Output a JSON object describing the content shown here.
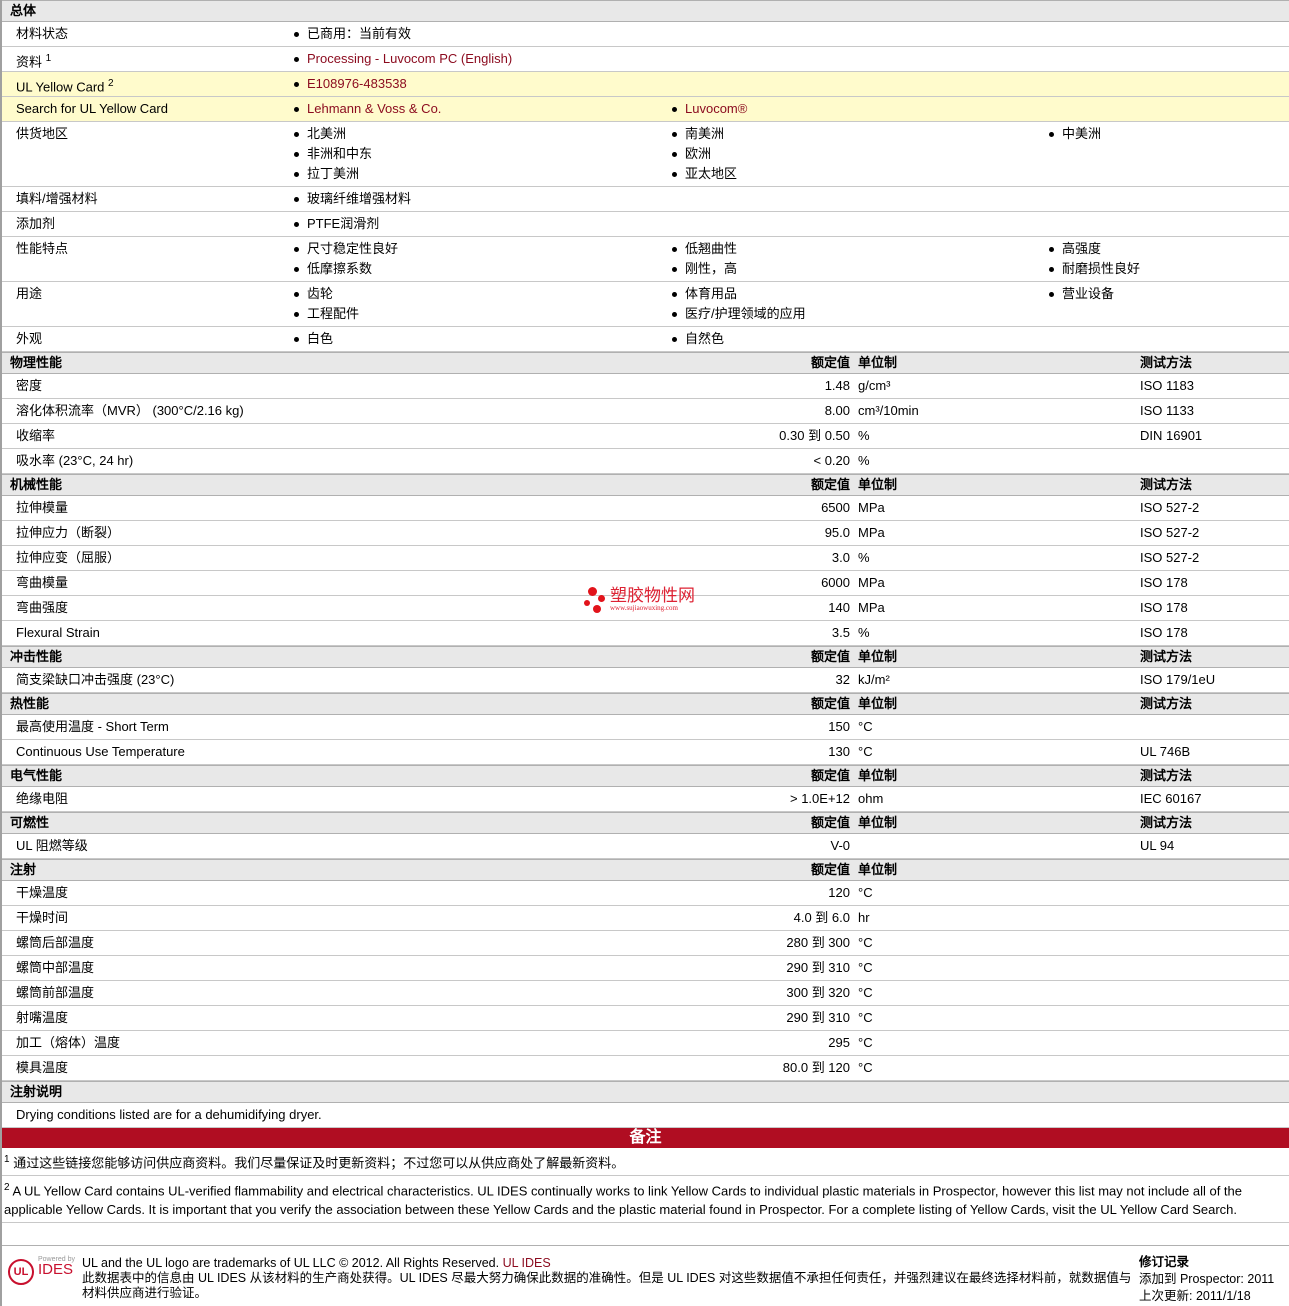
{
  "general": {
    "title": "总体",
    "rows": [
      {
        "label": "材料状态",
        "cols": [
          [
            "已商用：当前有效"
          ]
        ]
      },
      {
        "label": "资料",
        "sup": "1",
        "link": true,
        "cols": [
          [
            "Processing - Luvocom PC (English)"
          ]
        ]
      },
      {
        "label": "UL Yellow Card",
        "sup": "2",
        "link": true,
        "hl": true,
        "cols": [
          [
            "E108976-483538"
          ]
        ]
      },
      {
        "label": "Search for UL Yellow Card",
        "link": true,
        "hl": true,
        "cols": [
          [
            "Lehmann & Voss & Co."
          ],
          [
            "Luvocom®"
          ]
        ]
      },
      {
        "label": "供货地区",
        "cols": [
          [
            "北美洲",
            "非洲和中东",
            "拉丁美洲"
          ],
          [
            "南美洲",
            "欧洲",
            "亚太地区"
          ],
          [
            "中美洲"
          ]
        ]
      },
      {
        "label": "填料/增强材料",
        "cols": [
          [
            "玻璃纤维增强材料"
          ]
        ]
      },
      {
        "label": "添加剂",
        "cols": [
          [
            "PTFE润滑剂"
          ]
        ]
      },
      {
        "label": "性能特点",
        "cols": [
          [
            "尺寸稳定性良好",
            "低摩擦系数"
          ],
          [
            "低翘曲性",
            "刚性，高"
          ],
          [
            "高强度",
            "耐磨损性良好"
          ]
        ]
      },
      {
        "label": "用途",
        "cols": [
          [
            "齿轮",
            "工程配件"
          ],
          [
            "体育用品",
            "医疗/护理领域的应用"
          ],
          [
            "营业设备"
          ]
        ]
      },
      {
        "label": "外观",
        "cols": [
          [
            "白色"
          ],
          [
            "自然色"
          ]
        ]
      }
    ]
  },
  "sections": [
    {
      "title": "物理性能",
      "value": "额定值",
      "unit": "单位制",
      "method": "测试方法",
      "rows": [
        {
          "label": "密度",
          "value": "1.48",
          "unit": "g/cm³",
          "method": "ISO 1183"
        },
        {
          "label": "溶化体积流率（MVR）  (300°C/2.16 kg)",
          "value": "8.00",
          "unit": "cm³/10min",
          "method": "ISO 1133"
        },
        {
          "label": "收缩率",
          "value": "0.30 到  0.50",
          "unit": "%",
          "method": "DIN 16901"
        },
        {
          "label": "吸水率  (23°C, 24 hr)",
          "value": "< 0.20",
          "unit": "%",
          "method": ""
        }
      ]
    },
    {
      "title": "机械性能",
      "value": "额定值",
      "unit": "单位制",
      "method": "测试方法",
      "rows": [
        {
          "label": "拉伸模量",
          "value": "6500",
          "unit": "MPa",
          "method": "ISO 527-2"
        },
        {
          "label": "拉伸应力（断裂）",
          "value": "95.0",
          "unit": "MPa",
          "method": "ISO 527-2"
        },
        {
          "label": "拉伸应变（屈服）",
          "value": "3.0",
          "unit": "%",
          "method": "ISO 527-2"
        },
        {
          "label": "弯曲模量",
          "value": "6000",
          "unit": "MPa",
          "method": "ISO 178"
        },
        {
          "label": "弯曲强度",
          "value": "140",
          "unit": "MPa",
          "method": "ISO 178"
        },
        {
          "label": "Flexural Strain",
          "value": "3.5",
          "unit": "%",
          "method": "ISO 178"
        }
      ]
    },
    {
      "title": "冲击性能",
      "value": "额定值",
      "unit": "单位制",
      "method": "测试方法",
      "rows": [
        {
          "label": "简支梁缺口冲击强度  (23°C)",
          "value": "32",
          "unit": "kJ/m²",
          "method": "ISO 179/1eU"
        }
      ]
    },
    {
      "title": "热性能",
      "value": "额定值",
      "unit": "单位制",
      "method": "测试方法",
      "rows": [
        {
          "label": "最高使用温度  - Short Term",
          "value": "150",
          "unit": "°C",
          "method": ""
        },
        {
          "label": "Continuous Use Temperature",
          "value": "130",
          "unit": "°C",
          "method": "UL 746B"
        }
      ]
    },
    {
      "title": "电气性能",
      "value": "额定值",
      "unit": "单位制",
      "method": "测试方法",
      "rows": [
        {
          "label": "绝缘电阻",
          "value": "> 1.0E+12",
          "unit": "ohm",
          "method": "IEC 60167"
        }
      ]
    },
    {
      "title": "可燃性",
      "value": "额定值",
      "unit": "单位制",
      "method": "测试方法",
      "rows": [
        {
          "label": "UL 阻燃等级",
          "value": "V-0",
          "unit": "",
          "method": "UL 94"
        }
      ]
    },
    {
      "title": "注射",
      "value": "额定值",
      "unit": "单位制",
      "method": "",
      "rows": [
        {
          "label": "干燥温度",
          "value": "120",
          "unit": "°C",
          "method": ""
        },
        {
          "label": "干燥时间",
          "value": "4.0 到  6.0",
          "unit": "hr",
          "method": ""
        },
        {
          "label": "螺筒后部温度",
          "value": "280 到  300",
          "unit": "°C",
          "method": ""
        },
        {
          "label": "螺筒中部温度",
          "value": "290 到  310",
          "unit": "°C",
          "method": ""
        },
        {
          "label": "螺筒前部温度",
          "value": "300 到  320",
          "unit": "°C",
          "method": ""
        },
        {
          "label": "射嘴温度",
          "value": "290 到  310",
          "unit": "°C",
          "method": ""
        },
        {
          "label": "加工（熔体）温度",
          "value": "295",
          "unit": "°C",
          "method": ""
        },
        {
          "label": "模具温度",
          "value": "80.0 到  120",
          "unit": "°C",
          "method": ""
        }
      ]
    }
  ],
  "injection_notes": {
    "title": "注射说明",
    "text": "Drying conditions listed are for a dehumidifying dryer."
  },
  "notes": {
    "title": "备注",
    "footnotes": [
      {
        "num": "1",
        "text": "通过这些链接您能够访问供应商资料。我们尽量保证及时更新资料；不过您可以从供应商处了解最新资料。"
      },
      {
        "num": "2",
        "text": "A UL Yellow Card contains UL-verified flammability and electrical characteristics. UL IDES continually works to link Yellow Cards to individual plastic materials in Prospector, however this list may not include all of the applicable Yellow Cards. It is important that you verify the association between these Yellow Cards and the plastic material found in Prospector. For a complete listing of Yellow Cards, visit the UL Yellow Card Search."
      }
    ]
  },
  "watermark": {
    "name": "塑胶物性网",
    "url": "www.sujiaowuxing.com"
  },
  "footer": {
    "logo_powered": "Powered by",
    "logo_ul": "UL",
    "logo_ides": "IDES",
    "trademark": "UL and the UL logo are trademarks of UL LLC © 2012. All Rights Reserved.",
    "trademark_link": "UL IDES",
    "disclaimer": "此数据表中的信息由  UL IDES 从该材料的生产商处获得。UL IDES 尽最大努力确保此数据的准确性。但是  UL IDES 对这些数据值不承担任何责任，并强烈建议在最终选择材料前，就数据值与材料供应商进行验证。",
    "revision_title": "修订记录",
    "added_label": "添加到  Prospector:",
    "added_value": "2011",
    "updated_label": "上次更新:",
    "updated_value": "2011/1/18"
  }
}
